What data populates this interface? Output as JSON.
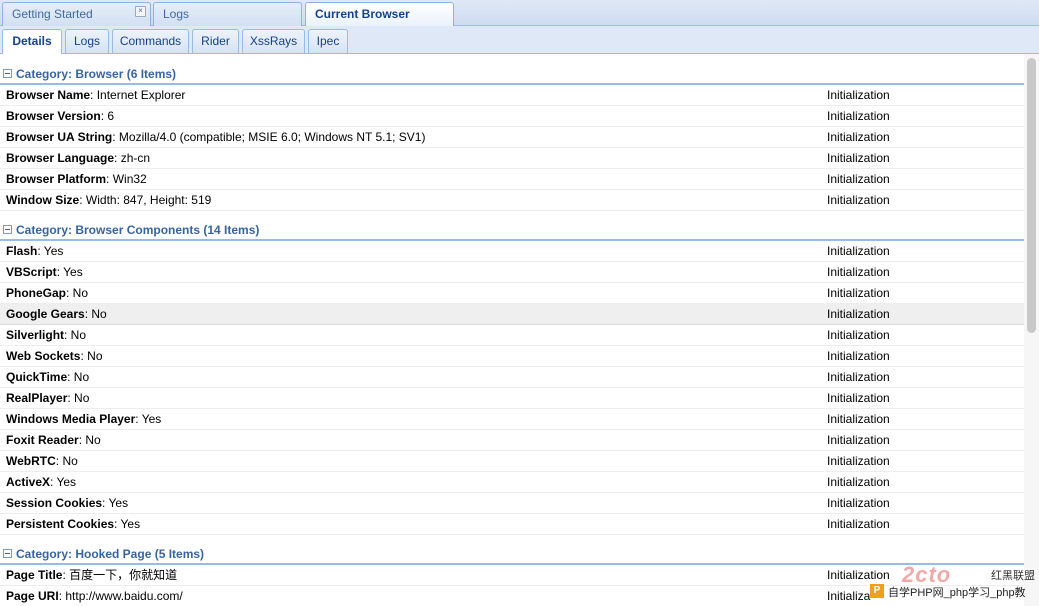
{
  "top_tabs": [
    {
      "label": "Getting Started"
    },
    {
      "label": "Logs"
    },
    {
      "label": "Current Browser"
    }
  ],
  "sub_tabs": [
    {
      "label": "Details"
    },
    {
      "label": "Logs"
    },
    {
      "label": "Commands"
    },
    {
      "label": "Rider"
    },
    {
      "label": "XssRays"
    },
    {
      "label": "Ipec"
    }
  ],
  "categories": [
    {
      "title": "Category: Browser (6 Items)",
      "rows": [
        {
          "key": "Browser Name",
          "value": ": Internet Explorer",
          "source": "Initialization"
        },
        {
          "key": "Browser Version",
          "value": ": 6",
          "source": "Initialization"
        },
        {
          "key": "Browser UA String",
          "value": ": Mozilla/4.0 (compatible; MSIE 6.0; Windows NT 5.1; SV1)",
          "source": "Initialization"
        },
        {
          "key": "Browser Language",
          "value": ": zh-cn",
          "source": "Initialization"
        },
        {
          "key": "Browser Platform",
          "value": ": Win32",
          "source": "Initialization"
        },
        {
          "key": "Window Size",
          "value": ": Width: 847, Height: 519",
          "source": "Initialization"
        }
      ]
    },
    {
      "title": "Category: Browser Components (14 Items)",
      "rows": [
        {
          "key": "Flash",
          "value": ": Yes",
          "source": "Initialization"
        },
        {
          "key": "VBScript",
          "value": ": Yes",
          "source": "Initialization"
        },
        {
          "key": "PhoneGap",
          "value": ": No",
          "source": "Initialization"
        },
        {
          "key": "Google Gears",
          "value": ": No",
          "source": "Initialization"
        },
        {
          "key": "Silverlight",
          "value": ": No",
          "source": "Initialization"
        },
        {
          "key": "Web Sockets",
          "value": ": No",
          "source": "Initialization"
        },
        {
          "key": "QuickTime",
          "value": ": No",
          "source": "Initialization"
        },
        {
          "key": "RealPlayer",
          "value": ": No",
          "source": "Initialization"
        },
        {
          "key": "Windows Media Player",
          "value": ": Yes",
          "source": "Initialization"
        },
        {
          "key": "Foxit Reader",
          "value": ": No",
          "source": "Initialization"
        },
        {
          "key": "WebRTC",
          "value": ": No",
          "source": "Initialization"
        },
        {
          "key": "ActiveX",
          "value": ": Yes",
          "source": "Initialization"
        },
        {
          "key": "Session Cookies",
          "value": ": Yes",
          "source": "Initialization"
        },
        {
          "key": "Persistent Cookies",
          "value": ": Yes",
          "source": "Initialization"
        }
      ]
    },
    {
      "title": "Category: Hooked Page (5 Items)",
      "rows": [
        {
          "key": "Page Title",
          "value": ": 百度一下，你就知道",
          "source": "Initialization"
        },
        {
          "key": "Page URI",
          "value": ": http://www.baidu.com/",
          "source": "Initializa"
        }
      ]
    }
  ],
  "watermark": {
    "logo_text": "2cto",
    "line1": "红黑联盟",
    "line2": "自学PHP网_php学习_php教",
    "badge": "P"
  },
  "colors": {
    "accent": "#15428b",
    "category_text": "#3764a0",
    "border": "#99bbe8"
  }
}
